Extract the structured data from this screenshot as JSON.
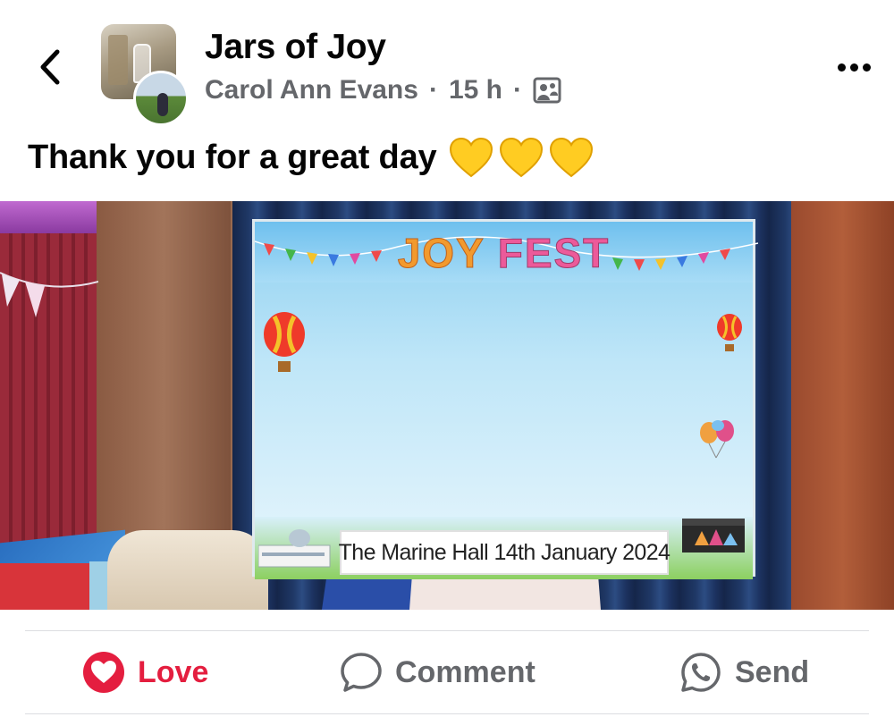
{
  "post": {
    "group_name": "Jars of Joy",
    "author": "Carol Ann Evans",
    "time": "15 h",
    "separator": "·",
    "audience_icon": "group-audience-icon",
    "caption_text": "Thank you for a great day",
    "caption_emoji": [
      "💛",
      "💛",
      "💛"
    ]
  },
  "photo": {
    "frame_title_part1": "JOY",
    "frame_title_part2": "FEST",
    "banner_text": "The Marine Hall 14th January 2024"
  },
  "actions": {
    "love_label": "Love",
    "comment_label": "Comment",
    "send_label": "Send"
  },
  "colors": {
    "love_active": "#e41e3f",
    "secondary_text": "#65676b",
    "primary_text": "#050505"
  }
}
